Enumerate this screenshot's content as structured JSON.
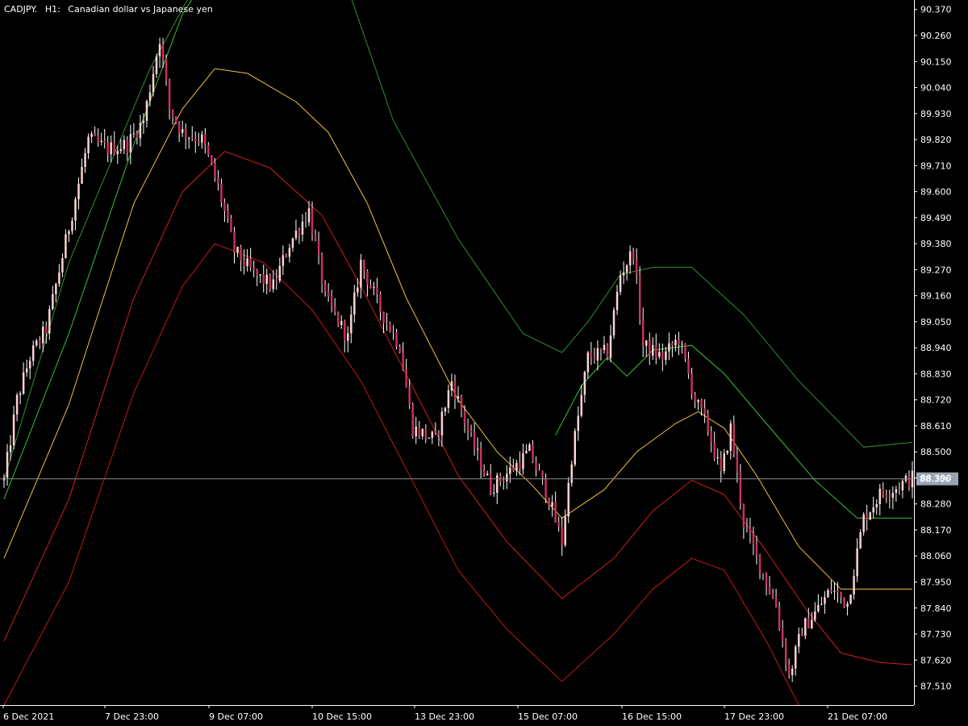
{
  "header": {
    "symbol": "CADJPY.",
    "timeframe": "H1:",
    "description": "Canadian dollar vs Japanese yen"
  },
  "colors": {
    "background": "#000000",
    "axis": "#ffffff",
    "bull_candle": "#ffd2d2",
    "bear_candle": "#c8325a",
    "wick": "#ffffff",
    "outer_upper_band": "#2f8f2f",
    "inner_upper_band": "#3cbf3c",
    "middle_band": "#f0c040",
    "inner_lower_band": "#d02020",
    "outer_lower_band": "#c01818",
    "last_price_line": "#888888",
    "last_price_box": "#9aa4b4"
  },
  "chart_data": {
    "type": "candlestick",
    "symbol": "CADJPY.",
    "timeframe": "H1",
    "title": "CADJPY., H1: Canadian dollar vs Japanese yen",
    "ylim": [
      87.43,
      90.41
    ],
    "y_ticks": [
      "90.370",
      "90.260",
      "90.150",
      "90.040",
      "89.930",
      "89.820",
      "89.710",
      "89.600",
      "89.490",
      "89.380",
      "89.270",
      "89.160",
      "89.050",
      "88.940",
      "88.830",
      "88.720",
      "88.610",
      "88.500",
      "88.390",
      "88.280",
      "88.170",
      "88.060",
      "87.950",
      "87.840",
      "87.730",
      "87.620",
      "87.510"
    ],
    "x_ticks": [
      "6 Dec 2021",
      "7 Dec 23:00",
      "9 Dec 07:00",
      "10 Dec 15:00",
      "13 Dec 23:00",
      "15 Dec 07:00",
      "16 Dec 15:00",
      "17 Dec 23:00",
      "21 Dec 07:00"
    ],
    "last_price": "88.386",
    "grid": false,
    "price_path_anchors": [
      {
        "bar": 0,
        "price": 88.38
      },
      {
        "bar": 4,
        "price": 88.72
      },
      {
        "bar": 8,
        "price": 88.9
      },
      {
        "bar": 13,
        "price": 89.02
      },
      {
        "bar": 20,
        "price": 89.45
      },
      {
        "bar": 26,
        "price": 89.82
      },
      {
        "bar": 32,
        "price": 89.78
      },
      {
        "bar": 38,
        "price": 89.8
      },
      {
        "bar": 43,
        "price": 89.9
      },
      {
        "bar": 48,
        "price": 90.25
      },
      {
        "bar": 51,
        "price": 89.95
      },
      {
        "bar": 55,
        "price": 89.85
      },
      {
        "bar": 61,
        "price": 89.82
      },
      {
        "bar": 66,
        "price": 89.62
      },
      {
        "bar": 71,
        "price": 89.35
      },
      {
        "bar": 77,
        "price": 89.25
      },
      {
        "bar": 83,
        "price": 89.2
      },
      {
        "bar": 88,
        "price": 89.38
      },
      {
        "bar": 94,
        "price": 89.52
      },
      {
        "bar": 99,
        "price": 89.15
      },
      {
        "bar": 106,
        "price": 88.98
      },
      {
        "bar": 110,
        "price": 89.3
      },
      {
        "bar": 116,
        "price": 89.1
      },
      {
        "bar": 122,
        "price": 88.95
      },
      {
        "bar": 126,
        "price": 88.6
      },
      {
        "bar": 133,
        "price": 88.55
      },
      {
        "bar": 138,
        "price": 88.8
      },
      {
        "bar": 144,
        "price": 88.55
      },
      {
        "bar": 150,
        "price": 88.35
      },
      {
        "bar": 156,
        "price": 88.42
      },
      {
        "bar": 162,
        "price": 88.5
      },
      {
        "bar": 168,
        "price": 88.3
      },
      {
        "bar": 172,
        "price": 88.12
      },
      {
        "bar": 175,
        "price": 88.48
      },
      {
        "bar": 180,
        "price": 88.9
      },
      {
        "bar": 186,
        "price": 88.92
      },
      {
        "bar": 190,
        "price": 89.25
      },
      {
        "bar": 194,
        "price": 89.35
      },
      {
        "bar": 197,
        "price": 88.95
      },
      {
        "bar": 203,
        "price": 88.9
      },
      {
        "bar": 208,
        "price": 88.98
      },
      {
        "bar": 213,
        "price": 88.72
      },
      {
        "bar": 217,
        "price": 88.6
      },
      {
        "bar": 221,
        "price": 88.4
      },
      {
        "bar": 224,
        "price": 88.6
      },
      {
        "bar": 228,
        "price": 88.2
      },
      {
        "bar": 233,
        "price": 88.02
      },
      {
        "bar": 238,
        "price": 87.85
      },
      {
        "bar": 242,
        "price": 87.55
      },
      {
        "bar": 246,
        "price": 87.75
      },
      {
        "bar": 250,
        "price": 87.82
      },
      {
        "bar": 255,
        "price": 87.92
      },
      {
        "bar": 260,
        "price": 87.86
      },
      {
        "bar": 265,
        "price": 88.22
      },
      {
        "bar": 270,
        "price": 88.32
      },
      {
        "bar": 275,
        "price": 88.35
      },
      {
        "bar": 280,
        "price": 88.39
      }
    ],
    "series": [
      {
        "role": "outer_upper_band",
        "points": [
          [
            0,
            88.38
          ],
          [
            20,
            89.3
          ],
          [
            45,
            90.12
          ],
          [
            60,
            90.5
          ],
          [
            100,
            90.7
          ],
          [
            120,
            89.9
          ],
          [
            140,
            89.4
          ],
          [
            160,
            89.0
          ],
          [
            172,
            88.92
          ],
          [
            180,
            89.05
          ],
          [
            190,
            89.25
          ],
          [
            200,
            89.28
          ],
          [
            212,
            89.28
          ],
          [
            228,
            89.08
          ],
          [
            245,
            88.8
          ],
          [
            265,
            88.52
          ],
          [
            280,
            88.54
          ]
        ]
      },
      {
        "role": "inner_upper_band",
        "points": [
          [
            0,
            88.3
          ],
          [
            20,
            89.0
          ],
          [
            40,
            89.8
          ],
          [
            55,
            90.35
          ],
          [
            62,
            90.5
          ]
        ]
      },
      {
        "role": "inner_upper_band",
        "points": [
          [
            170,
            88.57
          ],
          [
            178,
            88.78
          ],
          [
            186,
            88.9
          ],
          [
            192,
            88.82
          ],
          [
            200,
            88.93
          ],
          [
            212,
            88.95
          ],
          [
            222,
            88.83
          ],
          [
            235,
            88.62
          ],
          [
            250,
            88.38
          ],
          [
            263,
            88.22
          ],
          [
            280,
            88.22
          ]
        ]
      },
      {
        "role": "middle_band",
        "points": [
          [
            0,
            88.05
          ],
          [
            20,
            88.7
          ],
          [
            40,
            89.55
          ],
          [
            55,
            89.95
          ],
          [
            65,
            90.12
          ],
          [
            75,
            90.1
          ],
          [
            90,
            89.98
          ],
          [
            100,
            89.85
          ],
          [
            112,
            89.55
          ],
          [
            124,
            89.15
          ],
          [
            140,
            88.72
          ],
          [
            152,
            88.5
          ],
          [
            162,
            88.37
          ],
          [
            172,
            88.22
          ],
          [
            185,
            88.34
          ],
          [
            195,
            88.5
          ],
          [
            207,
            88.62
          ],
          [
            214,
            88.67
          ],
          [
            222,
            88.6
          ],
          [
            232,
            88.4
          ],
          [
            245,
            88.1
          ],
          [
            258,
            87.92
          ],
          [
            270,
            87.92
          ],
          [
            280,
            87.92
          ]
        ]
      },
      {
        "role": "inner_lower_band",
        "points": [
          [
            0,
            87.7
          ],
          [
            20,
            88.3
          ],
          [
            40,
            89.15
          ],
          [
            55,
            89.6
          ],
          [
            68,
            89.77
          ],
          [
            82,
            89.7
          ],
          [
            98,
            89.5
          ],
          [
            110,
            89.2
          ],
          [
            125,
            88.8
          ],
          [
            140,
            88.4
          ],
          [
            155,
            88.12
          ],
          [
            172,
            87.88
          ],
          [
            188,
            88.05
          ],
          [
            200,
            88.25
          ],
          [
            212,
            88.38
          ],
          [
            222,
            88.32
          ],
          [
            235,
            88.08
          ],
          [
            248,
            87.82
          ],
          [
            258,
            87.65
          ],
          [
            270,
            87.61
          ],
          [
            280,
            87.6
          ]
        ]
      },
      {
        "role": "outer_lower_band",
        "points": [
          [
            0,
            87.43
          ],
          [
            20,
            87.95
          ],
          [
            40,
            88.75
          ],
          [
            55,
            89.2
          ],
          [
            65,
            89.38
          ],
          [
            80,
            89.3
          ],
          [
            95,
            89.1
          ],
          [
            110,
            88.8
          ],
          [
            125,
            88.4
          ],
          [
            140,
            88.0
          ],
          [
            155,
            87.75
          ],
          [
            172,
            87.53
          ],
          [
            188,
            87.73
          ],
          [
            200,
            87.92
          ],
          [
            212,
            88.05
          ],
          [
            222,
            88.0
          ],
          [
            235,
            87.7
          ],
          [
            245,
            87.43
          ]
        ]
      }
    ]
  }
}
